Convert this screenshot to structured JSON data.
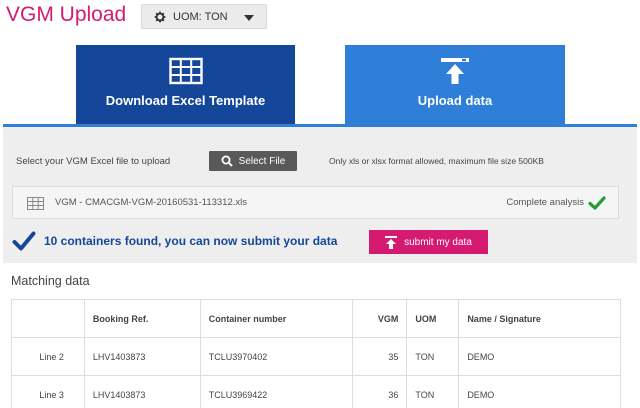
{
  "header": {
    "title": "VGM Upload",
    "uom_label": "UOM: TON"
  },
  "tabs": [
    {
      "label": "Download Excel Template",
      "icon": "table-grid-icon",
      "active": false
    },
    {
      "label": "Upload data",
      "icon": "upload-arrow-icon",
      "active": true
    }
  ],
  "upload": {
    "select_label": "Select your VGM Excel file to upload",
    "select_button": "Select File",
    "format_note": "Only xls or xlsx format allowed, maximum file size 500KB",
    "file_name": "VGM - CMACGM-VGM-20160531-113312.xls",
    "analysis_status": "Complete analysis"
  },
  "result": {
    "found_text": "10 containers found, you can now submit your data",
    "submit_button": "submit my data"
  },
  "matching": {
    "title": "Matching data",
    "columns": [
      "",
      "Booking Ref.",
      "Container number",
      "VGM",
      "UOM",
      "Name / Signature"
    ],
    "rows": [
      [
        "Line 2",
        "LHV1403873",
        "TCLU3970402",
        "35",
        "TON",
        "DEMO"
      ],
      [
        "Line 3",
        "LHV1403873",
        "TCLU3969422",
        "36",
        "TON",
        "DEMO"
      ]
    ]
  },
  "colors": {
    "brand_pink": "#d41b71",
    "dark_blue": "#14479a",
    "light_blue": "#2f7fd8",
    "check_green": "#2a9a3a"
  }
}
